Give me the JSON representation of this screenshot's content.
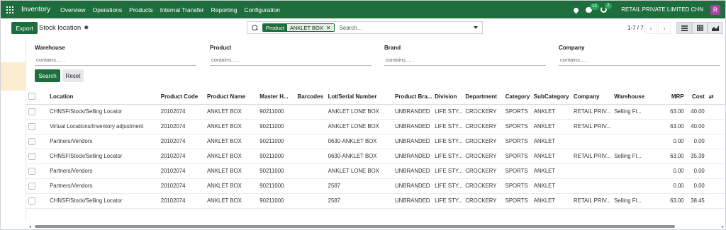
{
  "nav": {
    "app": "Inventory",
    "menu": [
      "Overview",
      "Operations",
      "Products",
      "Internal Transfer",
      "Reporting",
      "Configuration"
    ],
    "messages_badge": "12",
    "activity_badge": "2",
    "company": "RETAIL PRIVATE LIMITED CHN",
    "avatar_initial": "R"
  },
  "control": {
    "export_label": "Export",
    "title": "Stock location",
    "facet_key": "Product",
    "facet_value": "ANKLET BOX",
    "search_placeholder": "Search...",
    "pager": "1-7 / 7"
  },
  "filters": {
    "warehouse_label": "Warehouse",
    "product_label": "Product",
    "brand_label": "Brand",
    "company_label": "Company",
    "placeholder": "contains.... .",
    "search_button": "Search",
    "reset_button": "Reset"
  },
  "table": {
    "headers": [
      "Location",
      "Product Code",
      "Product Name",
      "Master H...",
      "Barcodes",
      "Lot/Serial Number",
      "Product Bra...",
      "Division",
      "Department",
      "Category",
      "SubCategory",
      "Company",
      "Warehouse",
      "MRP",
      "Cost"
    ],
    "rows": [
      [
        "CHNSF/Stock/Selling Locator",
        "20102074",
        "ANKLET BOX",
        "90211000",
        "",
        "ANKLET LONE BOX",
        "UNBRANDED",
        "LIFE STY...",
        "CROCKERY",
        "SPORTS",
        "ANKLET",
        "RETAIL PRIV...",
        "Selling Fl...",
        "63.00",
        "40.00"
      ],
      [
        "Virtual Locations/Inventory adjustment",
        "20102074",
        "ANKLET BOX",
        "90211000",
        "",
        "ANKLET LONE BOX",
        "UNBRANDED",
        "LIFE STY...",
        "CROCKERY",
        "SPORTS",
        "ANKLET",
        "RETAIL PRIV...",
        "",
        "63.00",
        "40.00"
      ],
      [
        "Partners/Vendors",
        "20102074",
        "ANKLET BOX",
        "90211000",
        "",
        "0630-ANKLET BOX",
        "UNBRANDED",
        "LIFE STY...",
        "CROCKERY",
        "SPORTS",
        "ANKLET",
        "",
        "",
        "0.00",
        "0.00"
      ],
      [
        "CHNSF/Stock/Selling Locator",
        "20102074",
        "ANKLET BOX",
        "90211000",
        "",
        "0630-ANKLET BOX",
        "UNBRANDED",
        "LIFE STY...",
        "CROCKERY",
        "SPORTS",
        "ANKLET",
        "RETAIL PRIV...",
        "Selling Fl...",
        "63.00",
        "35.39"
      ],
      [
        "Partners/Vendors",
        "20102074",
        "ANKLET BOX",
        "90211000",
        "",
        "ANKLET LONE BOX",
        "UNBRANDED",
        "LIFE STY...",
        "CROCKERY",
        "SPORTS",
        "ANKLET",
        "",
        "",
        "0.00",
        "0.00"
      ],
      [
        "Partners/Vendors",
        "20102074",
        "ANKLET BOX",
        "90211000",
        "",
        "2587",
        "UNBRANDED",
        "LIFE STY...",
        "CROCKERY",
        "SPORTS",
        "ANKLET",
        "",
        "",
        "0.00",
        "0.00"
      ],
      [
        "CHNSF/Stock/Selling Locator",
        "20102074",
        "ANKLET BOX",
        "90211000",
        "",
        "2587",
        "UNBRANDED",
        "LIFE STY...",
        "CROCKERY",
        "SPORTS",
        "ANKLET",
        "RETAIL PRIV...",
        "Selling Fl...",
        "63.00",
        "38.45"
      ]
    ]
  },
  "colors": {
    "primary": "#1e6e3d",
    "avatar": "#a3479a",
    "sidebar_highlight": "#fcecd0"
  }
}
